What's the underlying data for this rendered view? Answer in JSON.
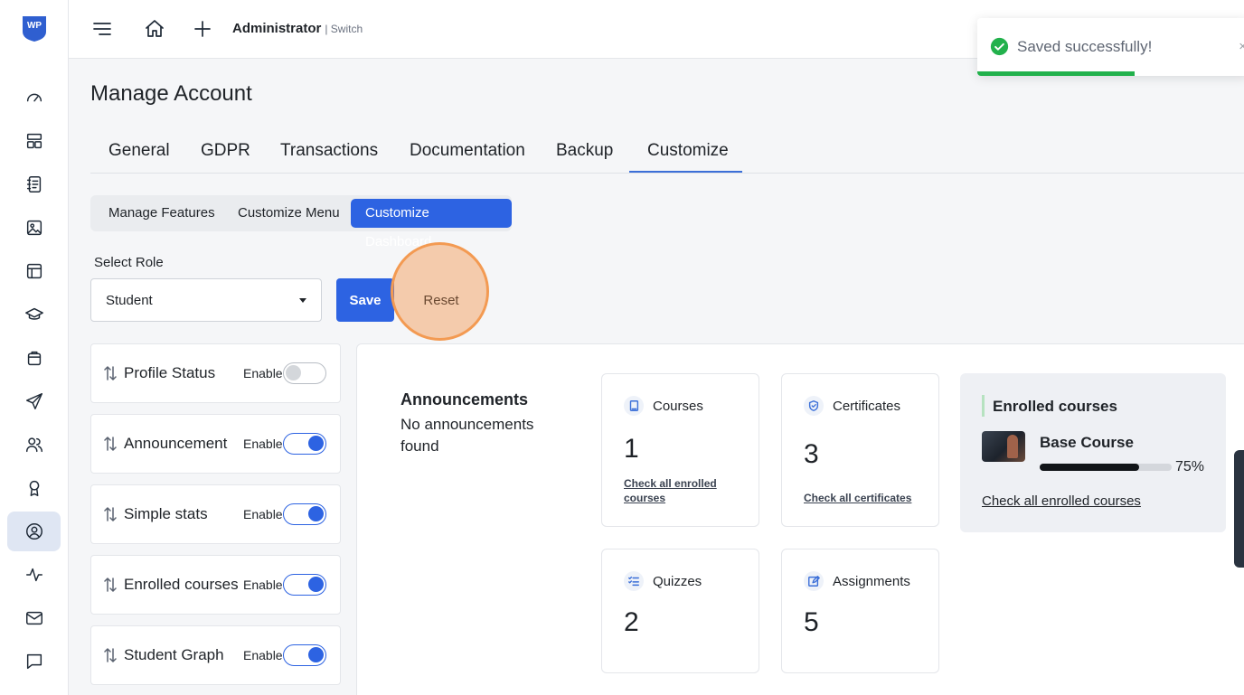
{
  "app": {
    "logo_text": "WP"
  },
  "sidebar": {
    "items": [
      {
        "icon": "dashboard-gauge-icon",
        "active": false
      },
      {
        "icon": "layout-icon",
        "active": false
      },
      {
        "icon": "notebook-icon",
        "active": false
      },
      {
        "icon": "image-icon",
        "active": false
      },
      {
        "icon": "template-icon",
        "active": false
      },
      {
        "icon": "graduation-cap-icon",
        "active": false
      },
      {
        "icon": "shopping-bag-icon",
        "active": false
      },
      {
        "icon": "send-icon",
        "active": false
      },
      {
        "icon": "users-icon",
        "active": false
      },
      {
        "icon": "award-icon",
        "active": false
      },
      {
        "icon": "user-circle-icon",
        "active": true
      },
      {
        "icon": "activity-icon",
        "active": false
      },
      {
        "icon": "mail-icon",
        "active": false
      },
      {
        "icon": "chat-icon",
        "active": false
      }
    ]
  },
  "topbar": {
    "user_role": "Administrator",
    "switch_label": "| Switch"
  },
  "toast": {
    "message": "Saved successfully!",
    "close": "×",
    "progress": 0.58
  },
  "page": {
    "title": "Manage Account"
  },
  "tabs": [
    "General",
    "GDPR",
    "Transactions",
    "Documentation",
    "Backup",
    "Customize"
  ],
  "active_tab": "Customize",
  "subtabs": [
    "Manage Features",
    "Customize Menu",
    "Customize Dashboard"
  ],
  "active_subtab": "Customize Dashboard",
  "role": {
    "label": "Select Role",
    "value": "Student"
  },
  "buttons": {
    "save": "Save",
    "reset": "Reset"
  },
  "features": [
    {
      "name": "Profile Status",
      "enable_label": "Enable",
      "enabled": false
    },
    {
      "name": "Announcement",
      "enable_label": "Enable",
      "enabled": true
    },
    {
      "name": "Simple stats",
      "enable_label": "Enable",
      "enabled": true
    },
    {
      "name": "Enrolled courses",
      "enable_label": "Enable",
      "enabled": true
    },
    {
      "name": "Student Graph",
      "enable_label": "Enable",
      "enabled": true
    }
  ],
  "preview": {
    "announcements": {
      "title": "Announcements",
      "body": "No announcements found"
    },
    "stats": [
      {
        "title": "Courses",
        "value": "1",
        "link": "Check all enrolled courses",
        "icon": "book-icon"
      },
      {
        "title": "Certificates",
        "value": "3",
        "link": "Check all certificates",
        "icon": "shield-check-icon"
      },
      {
        "title": "Quizzes",
        "value": "2",
        "icon": "checklist-icon"
      },
      {
        "title": "Assignments",
        "value": "5",
        "icon": "edit-icon"
      }
    ],
    "enrolled": {
      "title": "Enrolled courses",
      "course": "Base Course",
      "progress": 75,
      "progress_label": "75%",
      "link": "Check all enrolled courses"
    }
  },
  "colors": {
    "primary": "#2d63e2",
    "toast_success": "#22b14c",
    "reset_highlight": "#f39a52"
  }
}
